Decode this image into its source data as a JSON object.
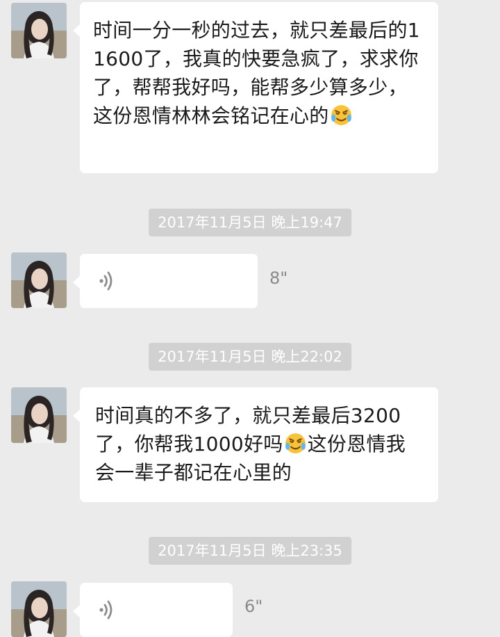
{
  "messages": [
    {
      "type": "text",
      "parts": [
        "时间一分一秒的过去，就只差最后的11600了，我真的快要急疯了，求求你了，帮帮我好吗，能帮多少算多少，这份恩情林林会铭记在心的",
        ""
      ],
      "emoji": "crying-laughing-emoji"
    },
    {
      "type": "timestamp",
      "text": "2017年11月5日 晚上19:47"
    },
    {
      "type": "voice",
      "duration": "8\""
    },
    {
      "type": "timestamp",
      "text": "2017年11月5日 晚上22:02"
    },
    {
      "type": "text",
      "parts": [
        "时间真的不多了，就只差最后3200了，你帮我1000好吗",
        "这份恩情我会一辈子都记在心里的"
      ],
      "emoji": "crying-laughing-emoji"
    },
    {
      "type": "timestamp",
      "text": "2017年11月5日 晚上23:35"
    },
    {
      "type": "voice",
      "duration": "6\""
    }
  ],
  "colors": {
    "background": "#ebebeb",
    "bubble": "#ffffff",
    "timestamp_bg": "#d1d1d1",
    "timestamp_text": "#ffffff",
    "voice_duration": "#8a8a8a"
  }
}
